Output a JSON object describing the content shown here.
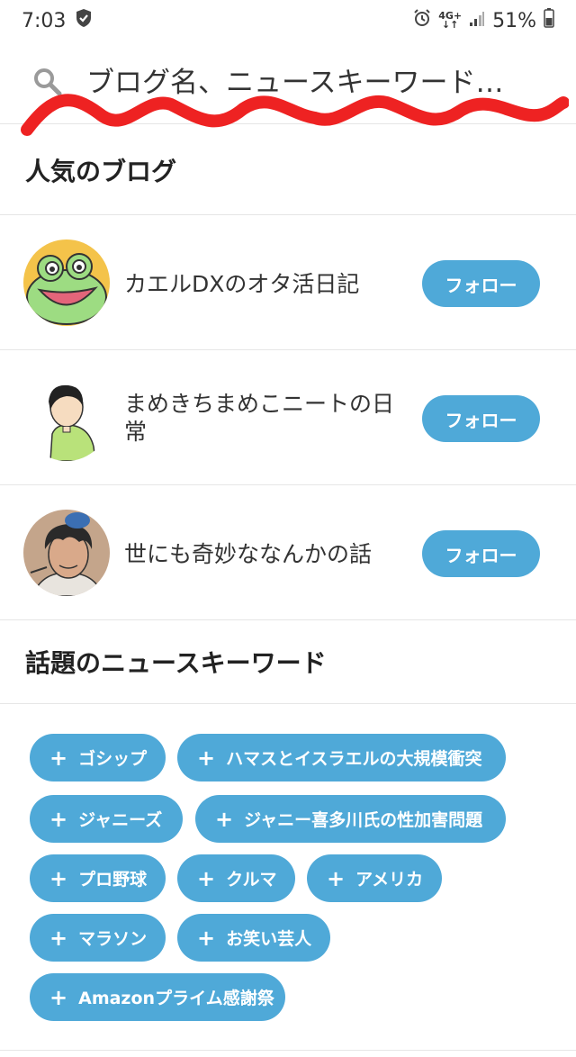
{
  "status_bar": {
    "time": "7:03",
    "network_top": "4G+",
    "network_bottom": "↓↑",
    "battery": "51%"
  },
  "search": {
    "placeholder": "ブログ名、ニュースキーワード…"
  },
  "popular_blogs": {
    "title": "人気のブログ",
    "items": [
      {
        "name": "カエルDXのオタ活日記",
        "follow_label": "フォロー"
      },
      {
        "name": "まめきちまめこニートの日常",
        "follow_label": "フォロー"
      },
      {
        "name": "世にも奇妙ななんかの話",
        "follow_label": "フォロー"
      }
    ]
  },
  "news_keywords": {
    "title": "話題のニュースキーワード",
    "items": [
      {
        "label": "ゴシップ"
      },
      {
        "label": "ハマスとイスラエルの大規模衝突"
      },
      {
        "label": "ジャニーズ"
      },
      {
        "label": "ジャニー喜多川氏の性加害問題"
      },
      {
        "label": "プロ野球"
      },
      {
        "label": "クルマ"
      },
      {
        "label": "アメリカ"
      },
      {
        "label": "マラソン"
      },
      {
        "label": "お笑い芸人"
      },
      {
        "label": "Amazonプライム感謝祭"
      }
    ]
  },
  "colors": {
    "accent": "#4fa9d8",
    "annotation_red": "#ee2222"
  }
}
